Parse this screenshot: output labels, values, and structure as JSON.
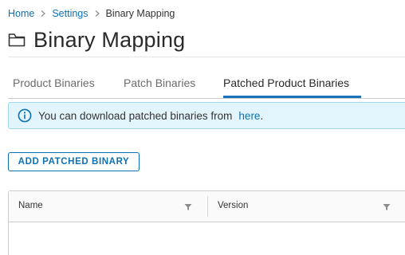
{
  "breadcrumb": {
    "items": [
      {
        "label": "Home"
      },
      {
        "label": "Settings"
      },
      {
        "label": "Binary Mapping"
      }
    ]
  },
  "header": {
    "title": "Binary Mapping",
    "icon": "folder-icon"
  },
  "tabs": [
    {
      "label": "Product Binaries",
      "active": false
    },
    {
      "label": "Patch Binaries",
      "active": false
    },
    {
      "label": "Patched Product Binaries",
      "active": true
    }
  ],
  "alert": {
    "icon": "info-icon",
    "text": "You can download patched binaries from",
    "link_text": "here",
    "suffix": "."
  },
  "actions": {
    "add_button_label": "ADD PATCHED BINARY"
  },
  "table": {
    "columns": [
      {
        "label": "Name",
        "filter_icon": "filter-icon"
      },
      {
        "label": "Version",
        "filter_icon": "filter-icon"
      }
    ],
    "rows": []
  },
  "colors": {
    "accent": "#0b72b5",
    "alert_bg": "#e3f5fc",
    "alert_border": "#9fd8ee",
    "tab_underline": "#1a73ba"
  }
}
